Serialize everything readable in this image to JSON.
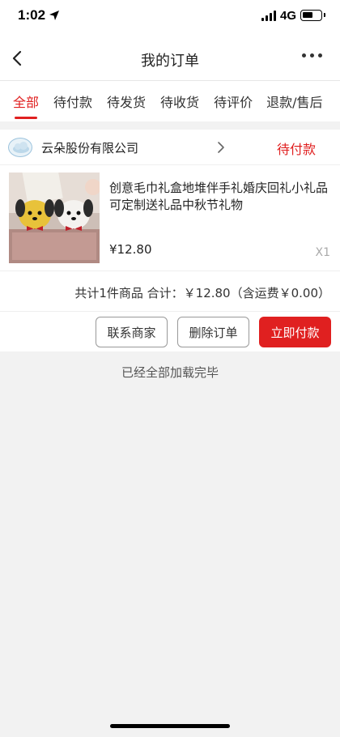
{
  "status_bar": {
    "time": "1:02",
    "network": "4G"
  },
  "header": {
    "title": "我的订单",
    "back_icon": "chevron-left-icon",
    "more_icon": "more-dots-icon"
  },
  "tabs": [
    {
      "label": "全部",
      "active": true
    },
    {
      "label": "待付款",
      "active": false
    },
    {
      "label": "待发货",
      "active": false
    },
    {
      "label": "待收货",
      "active": false
    },
    {
      "label": "待评价",
      "active": false
    },
    {
      "label": "退款/售后",
      "active": false
    }
  ],
  "order": {
    "shop_name": "云朵股份有限公司",
    "status": "待付款",
    "product": {
      "title": "创意毛巾礼盒地堆伴手礼婚庆回礼小礼品可定制送礼品中秋节礼物",
      "price": "¥12.80",
      "quantity": "X1"
    },
    "summary": "共计1件商品 合计：￥12.80（含运费￥0.00）",
    "actions": {
      "contact": "联系商家",
      "delete": "删除订单",
      "pay": "立即付款"
    }
  },
  "footer_text": "已经全部加载完毕",
  "colors": {
    "accent": "#e02020",
    "background": "#f2f2f2"
  }
}
